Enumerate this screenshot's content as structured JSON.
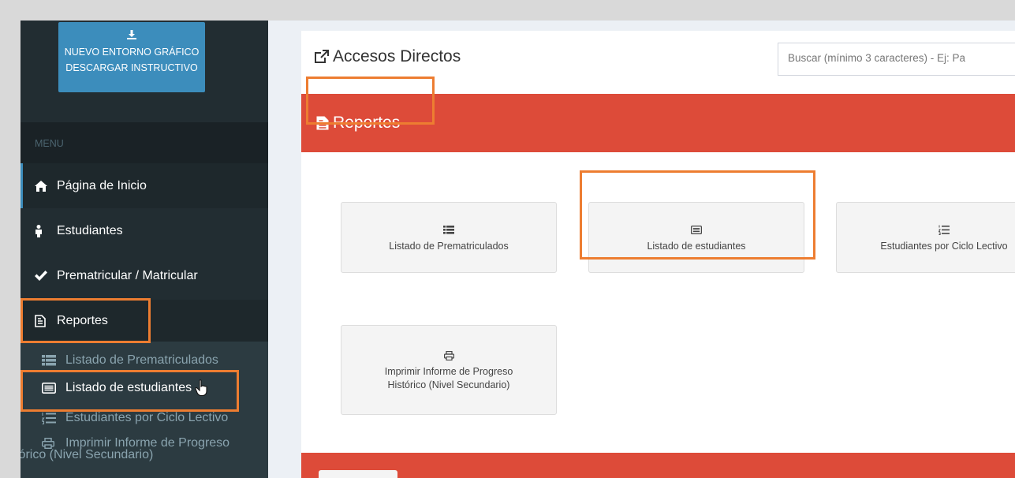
{
  "sidebar": {
    "download_button": {
      "line1": "NUEVO ENTORNO GRÁFICO",
      "line2": "DESCARGAR INSTRUCTIVO"
    },
    "menu_header": "MENU",
    "items": [
      {
        "label": "Página de Inicio",
        "icon": "home-icon"
      },
      {
        "label": "Estudiantes",
        "icon": "student-icon"
      },
      {
        "label": "Prematricular / Matricular",
        "icon": "check-icon"
      },
      {
        "label": "Reportes",
        "icon": "document-icon"
      }
    ],
    "submenu": [
      {
        "label": "Listado de Prematriculados",
        "icon": "list-icon"
      },
      {
        "label": "Listado de estudiantes",
        "icon": "card-list-icon"
      },
      {
        "label": "Estudiantes por Ciclo Lectivo",
        "icon": "ordered-list-icon"
      },
      {
        "label_line1": "Imprimir Informe de Progreso",
        "label_line2": "Histórico (Nivel Secundario)",
        "icon": "printer-icon"
      }
    ]
  },
  "main": {
    "title": "Accesos Directos",
    "search_placeholder": "Buscar (mínimo 3 caracteres) - Ej: Pa",
    "section_title": "Reportes",
    "tiles": [
      {
        "label": "Listado de Prematriculados",
        "icon": "list-icon"
      },
      {
        "label": "Listado de estudiantes",
        "icon": "card-list-icon"
      },
      {
        "label": "Estudiantes por Ciclo Lectivo",
        "icon": "ordered-list-icon"
      },
      {
        "label_line1": "Imprimir Informe de Progreso",
        "label_line2": "Histórico (Nivel Secundario)",
        "icon": "printer-icon"
      }
    ]
  },
  "colors": {
    "sidebar_bg": "#222d32",
    "accent_blue": "#3c8dbc",
    "section_red": "#dd4b39",
    "highlight_orange": "#ed7d31"
  }
}
